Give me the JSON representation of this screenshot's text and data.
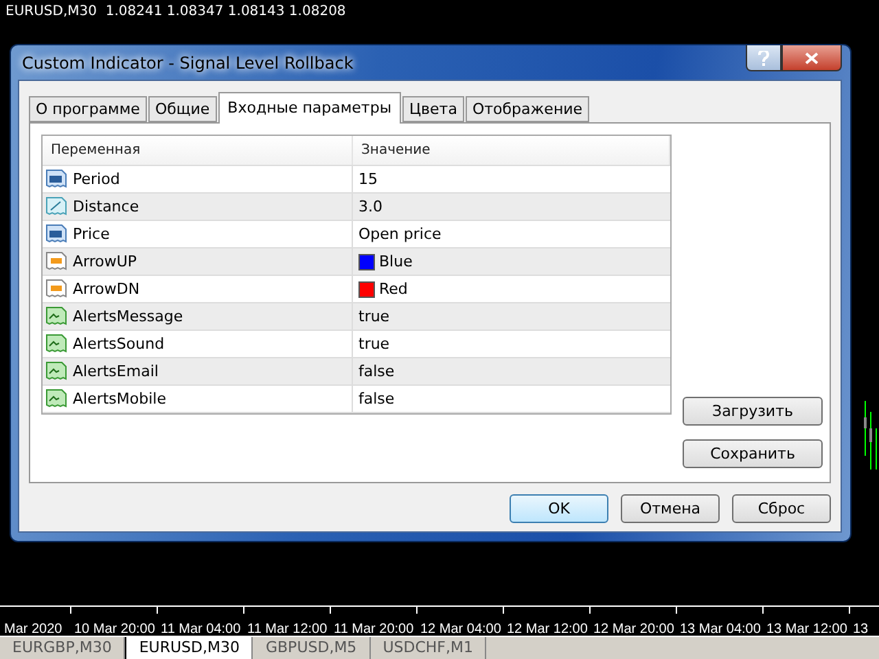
{
  "chart_header": "EURUSD,M30  1.08241 1.08347 1.08143 1.08208",
  "dialog": {
    "title": "Custom Indicator - Signal Level Rollback",
    "tabs": [
      {
        "label": "О программе",
        "selected": false
      },
      {
        "label": "Общие",
        "selected": false
      },
      {
        "label": "Входные параметры",
        "selected": true
      },
      {
        "label": "Цвета",
        "selected": false
      },
      {
        "label": "Отображение",
        "selected": false
      }
    ],
    "table": {
      "columns": [
        "Переменная",
        "Значение"
      ],
      "rows": [
        {
          "kind": "int",
          "name": "Period",
          "value": "15"
        },
        {
          "kind": "double",
          "name": "Distance",
          "value": "3.0"
        },
        {
          "kind": "int",
          "name": "Price",
          "value": "Open price"
        },
        {
          "kind": "color",
          "name": "ArrowUP",
          "value": "Blue",
          "color": "#0000ff"
        },
        {
          "kind": "color",
          "name": "ArrowDN",
          "value": "Red",
          "color": "#ff0000"
        },
        {
          "kind": "bool",
          "name": "AlertsMessage",
          "value": "true"
        },
        {
          "kind": "bool",
          "name": "AlertsSound",
          "value": "true"
        },
        {
          "kind": "bool",
          "name": "AlertsEmail",
          "value": "false"
        },
        {
          "kind": "bool",
          "name": "AlertsMobile",
          "value": "false"
        }
      ]
    },
    "side_buttons": [
      "Загрузить",
      "Сохранить"
    ],
    "buttons": [
      {
        "label": "OK",
        "selected": true
      },
      {
        "label": "Отмена",
        "selected": false
      },
      {
        "label": "Сброс",
        "selected": false
      }
    ]
  },
  "time_axis": [
    "Mar 2020",
    "10 Mar 20:00",
    "11 Mar 04:00",
    "11 Mar 12:00",
    "11 Mar 20:00",
    "12 Mar 04:00",
    "12 Mar 12:00",
    "12 Mar 20:00",
    "13 Mar 04:00",
    "13 Mar 12:00",
    "13"
  ],
  "chart_tabs": [
    {
      "label": "EURGBP,M30",
      "selected": false
    },
    {
      "label": "EURUSD,M30",
      "selected": true
    },
    {
      "label": "GBPUSD,M5",
      "selected": false
    },
    {
      "label": "USDCHF,M1",
      "selected": false
    }
  ]
}
